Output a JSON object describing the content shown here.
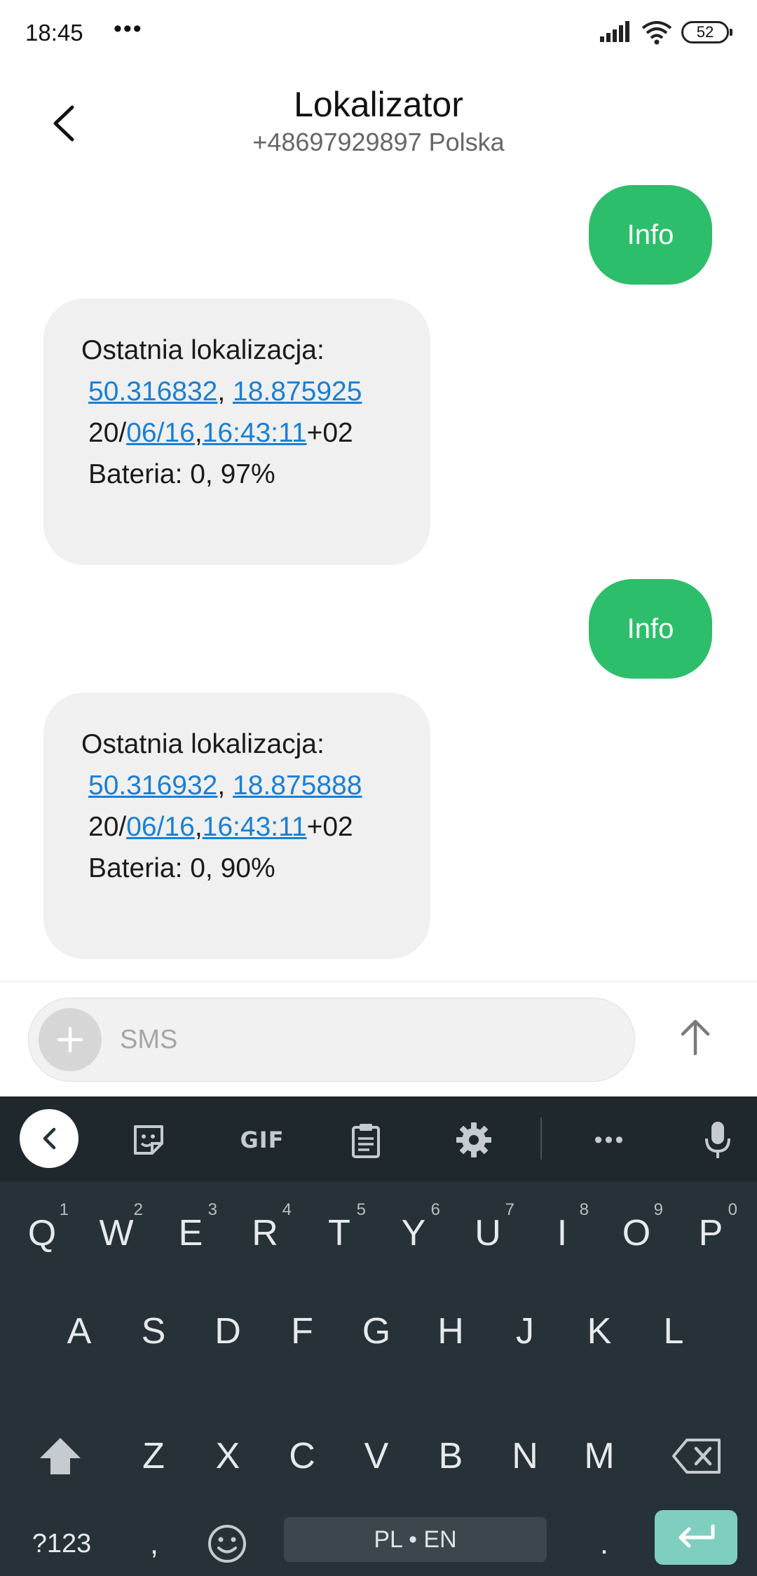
{
  "status_bar": {
    "time": "18:45",
    "more": "•••",
    "battery": "52"
  },
  "header": {
    "title": "Lokalizator",
    "subtitle": "+48697929897 Polska"
  },
  "messages": [
    {
      "direction": "outgoing",
      "text": "Info"
    },
    {
      "direction": "incoming",
      "label": "Ostatnia lokalizacja:",
      "lat": "50.316832",
      "sep": ", ",
      "lon": "18.875925",
      "date_prefix": "20/",
      "date_link": "06/16",
      "comma": ",",
      "time_link": "16:43:11",
      "tz": "+02",
      "battery": "Bateria:  0, 97%"
    },
    {
      "direction": "outgoing",
      "text": "Info"
    },
    {
      "direction": "incoming",
      "label": "Ostatnia lokalizacja:",
      "lat": "50.316932",
      "sep": ", ",
      "lon": "18.875888",
      "date_prefix": "20/",
      "date_link": "06/16",
      "comma": ",",
      "time_link": "16:43:11",
      "tz": "+02",
      "battery": "Bateria:  0, 90%"
    }
  ],
  "composer": {
    "placeholder": "SMS"
  },
  "keyboard": {
    "toolbar": {
      "gif": "GIF",
      "more": "•••"
    },
    "row1": [
      {
        "k": "Q",
        "h": "1"
      },
      {
        "k": "W",
        "h": "2"
      },
      {
        "k": "E",
        "h": "3"
      },
      {
        "k": "R",
        "h": "4"
      },
      {
        "k": "T",
        "h": "5"
      },
      {
        "k": "Y",
        "h": "6"
      },
      {
        "k": "U",
        "h": "7"
      },
      {
        "k": "I",
        "h": "8"
      },
      {
        "k": "O",
        "h": "9"
      },
      {
        "k": "P",
        "h": "0"
      }
    ],
    "row2": [
      "A",
      "S",
      "D",
      "F",
      "G",
      "H",
      "J",
      "K",
      "L"
    ],
    "row3": [
      "Z",
      "X",
      "C",
      "V",
      "B",
      "N",
      "M"
    ],
    "sym": "?123",
    "comma": ",",
    "space": "PL • EN",
    "period": "."
  },
  "colors": {
    "outgoing_bubble": "#2dbe6b",
    "incoming_bubble": "#f0f0f0",
    "link": "#1a7fd4",
    "keyboard_bg": "#263238",
    "enter_key": "#7fcfc1"
  }
}
